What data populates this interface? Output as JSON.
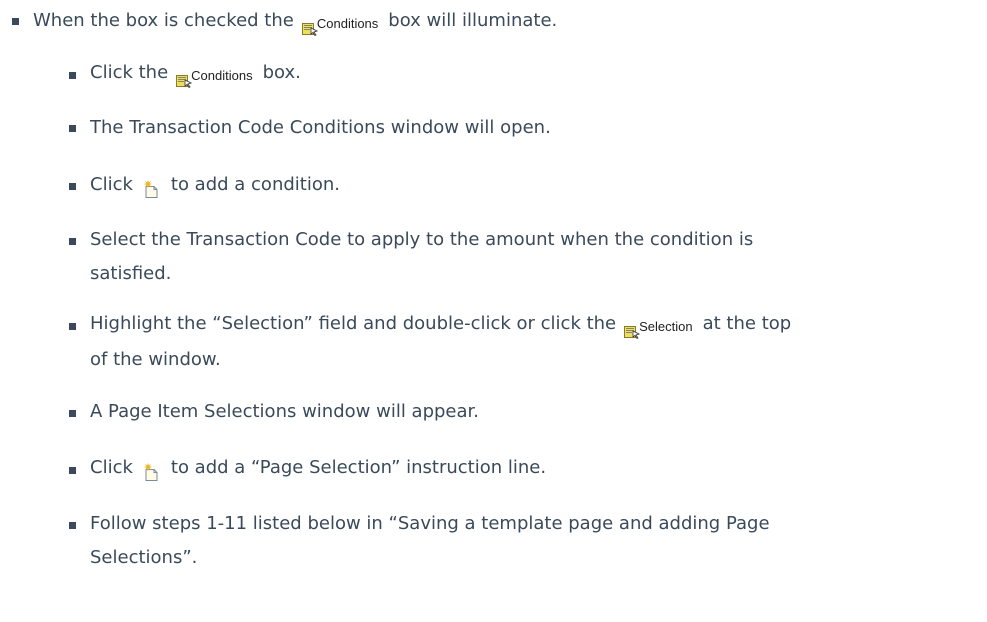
{
  "steps": [
    {
      "parts": [
        "When the box is checked the",
        "box will illuminate."
      ]
    },
    {
      "parts": [
        "Click the",
        "box."
      ]
    },
    {
      "text": "The Transaction Code Conditions window will open."
    },
    {
      "parts": [
        "Click",
        "to add a condition."
      ]
    },
    {
      "line1": "Select the Transaction Code to apply to the amount when the condition is",
      "line2": "satisfied."
    },
    {
      "parts": [
        "Highlight the “Selection” field and double-click or click the",
        "at the top"
      ],
      "line2": "of the window."
    },
    {
      "text": "A Page Item Selections window will appear."
    },
    {
      "parts": [
        "Click",
        "to add a “Page Selection” instruction line."
      ]
    },
    {
      "line1": "Follow steps 1-11 listed below in “Saving a template page and adding Page",
      "line2": "Selections”."
    }
  ],
  "buttons": {
    "conditions_label": "Conditions",
    "selection_label": "Selection",
    "conditions_icon": "conditions-button-icon",
    "selection_icon": "selection-button-icon",
    "add_icon": "new-item-icon"
  },
  "colors": {
    "text": "#3a4a5a",
    "icon_yellow": "#f2dc5d",
    "icon_green": "#8fbf4a"
  }
}
